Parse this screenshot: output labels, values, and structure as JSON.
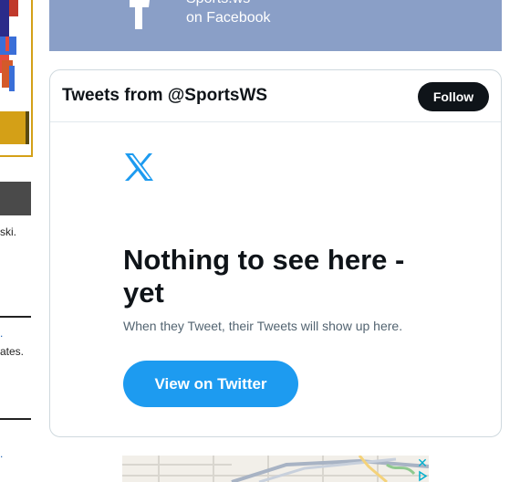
{
  "facebook": {
    "line1": "Sports.ws",
    "line2": "on Facebook"
  },
  "twitter": {
    "title": "Tweets from @SportsWS",
    "follow_label": "Follow",
    "empty_title": "Nothing to see here - yet",
    "empty_subtitle": "When they Tweet, their Tweets will show up here.",
    "view_button_label": "View on Twitter"
  },
  "left_column": {
    "snippet1": "ski.",
    "snippet2": "ates."
  },
  "colors": {
    "facebook_banner": "#8a9fc7",
    "twitter_blue": "#1d9bf0",
    "follow_black": "#0f1419"
  }
}
